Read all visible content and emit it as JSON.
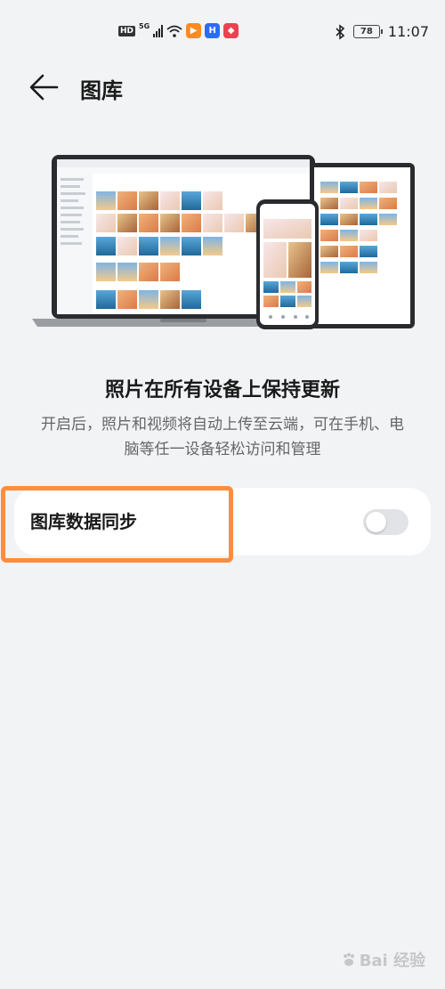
{
  "status_bar": {
    "network_badge": "HD",
    "network_type": "5G",
    "battery_level": "78",
    "time": "11:07",
    "notification_icons": [
      "video-app-icon",
      "orange-app-icon",
      "blue-app-icon",
      "red-app-icon"
    ]
  },
  "header": {
    "back_icon": "arrow-left-icon",
    "title": "图库"
  },
  "intro": {
    "headline": "照片在所有设备上保持更新",
    "description": "开启后，照片和视频将自动上传至云端，可在手机、电脑等任一设备轻松访问和管理"
  },
  "settings": {
    "sync_label": "图库数据同步",
    "sync_enabled": false
  },
  "colors": {
    "background": "#f1f3f5",
    "card": "#ffffff",
    "highlight": "#ff8d3d",
    "toggle_off": "#e1e3e6"
  },
  "watermark": "Bai 经验"
}
